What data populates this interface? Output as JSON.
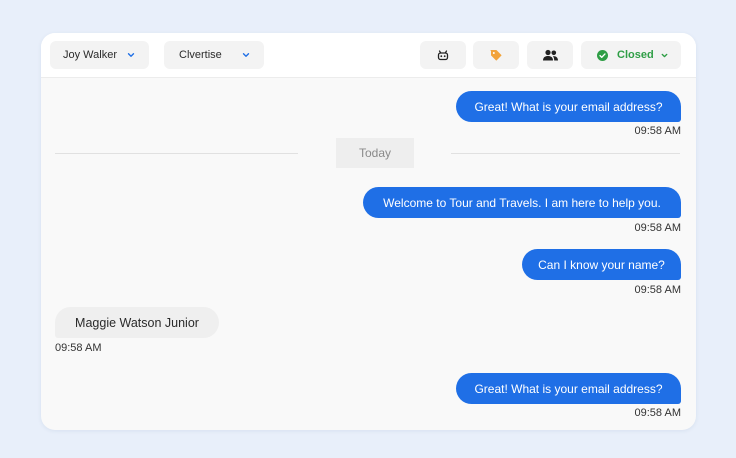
{
  "header": {
    "agent_dropdown": {
      "value": "Joy Walker"
    },
    "brand_dropdown": {
      "value": "Clvertise"
    },
    "status": {
      "label": "Closed",
      "color": "#2f9e46"
    },
    "icons": [
      "bot-icon",
      "tag-icon",
      "users-icon"
    ]
  },
  "colors": {
    "accent": "#1f6fe6",
    "tag": "#f2a33a",
    "status": "#2f9e46"
  },
  "chat": {
    "divider_label": "Today",
    "messages": [
      {
        "direction": "outgoing",
        "text": "Great! What is your email address?",
        "time": "09:58 AM"
      },
      {
        "direction": "outgoing",
        "text": "Welcome to Tour and Travels. I am here to help you.",
        "time": "09:58 AM"
      },
      {
        "direction": "outgoing",
        "text": "Can I know your name?",
        "time": "09:58 AM"
      },
      {
        "direction": "incoming",
        "text": "Maggie Watson Junior",
        "time": "09:58 AM"
      },
      {
        "direction": "outgoing",
        "text": "Great! What is your email address?",
        "time": "09:58 AM"
      }
    ]
  }
}
